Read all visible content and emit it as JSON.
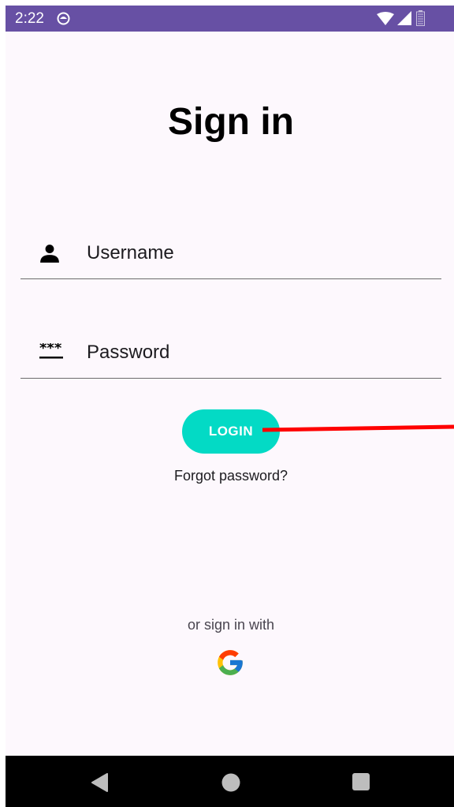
{
  "status_bar": {
    "time": "2:22",
    "background_color": "#6750a4",
    "icons": [
      "app-notification-icon",
      "wifi-icon",
      "signal-icon",
      "battery-icon"
    ]
  },
  "title": "Sign in",
  "username": {
    "placeholder": "Username",
    "value": "",
    "icon": "person-icon"
  },
  "password": {
    "placeholder": "Password",
    "value": "",
    "icon": "password-icon"
  },
  "login_button": {
    "label": "LOGIN",
    "color": "#03dac5"
  },
  "forgot_password": "Forgot password?",
  "alt_sign_in": {
    "label": "or sign in with",
    "provider_icon": "google-icon"
  },
  "annotation": {
    "color": "#ff0000",
    "icon": "red-pointer-line"
  },
  "nav_bar": {
    "buttons": [
      "back-icon",
      "home-icon",
      "recents-icon"
    ]
  }
}
